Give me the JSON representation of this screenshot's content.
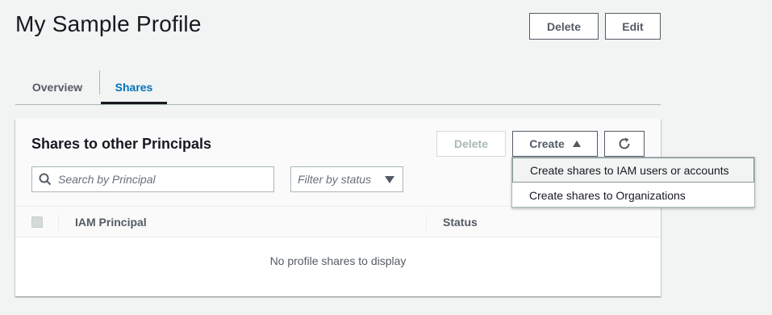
{
  "header": {
    "title": "My Sample Profile",
    "delete_label": "Delete",
    "edit_label": "Edit"
  },
  "tabs": [
    {
      "label": "Overview",
      "active": false
    },
    {
      "label": "Shares",
      "active": true
    }
  ],
  "card": {
    "title": "Shares to other Principals",
    "delete_label": "Delete",
    "create_label": "Create",
    "refresh_icon": "refresh-icon",
    "search": {
      "placeholder": "Search by Principal",
      "value": ""
    },
    "filter": {
      "label": "Filter by status"
    },
    "table": {
      "columns": [
        "IAM Principal",
        "Status"
      ],
      "empty_message": "No profile shares to display"
    }
  },
  "create_menu": {
    "items": [
      {
        "label": "Create shares to IAM users or accounts"
      },
      {
        "label": "Create shares to Organizations"
      }
    ]
  },
  "colors": {
    "accent": "#0073bb",
    "text": "#16191f",
    "muted": "#545b64",
    "background": "#f2f3f3"
  }
}
